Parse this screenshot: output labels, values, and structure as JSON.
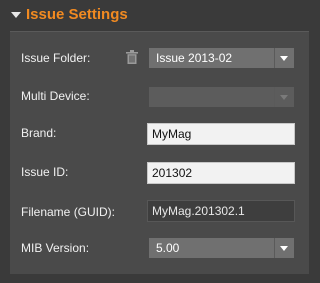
{
  "header": {
    "title": "Issue Settings"
  },
  "rows": {
    "issue_folder": {
      "label": "Issue Folder:",
      "value": "Issue 2013-02"
    },
    "multi_device": {
      "label": "Multi Device:",
      "value": ""
    },
    "brand": {
      "label": "Brand:",
      "value": "MyMag"
    },
    "issue_id": {
      "label": "Issue ID:",
      "value": "201302"
    },
    "filename": {
      "label": "Filename (GUID):",
      "value": "MyMag.201302.1"
    },
    "mib_version": {
      "label": "MIB Version:",
      "value": "5.00"
    }
  },
  "icons": {
    "delete": "trash-icon",
    "collapse": "collapse-triangle-icon",
    "dropdown": "chevron-down-icon"
  },
  "colors": {
    "accent": "#f18a21",
    "panel": "#4a4a4a",
    "background": "#3a3a3a"
  }
}
